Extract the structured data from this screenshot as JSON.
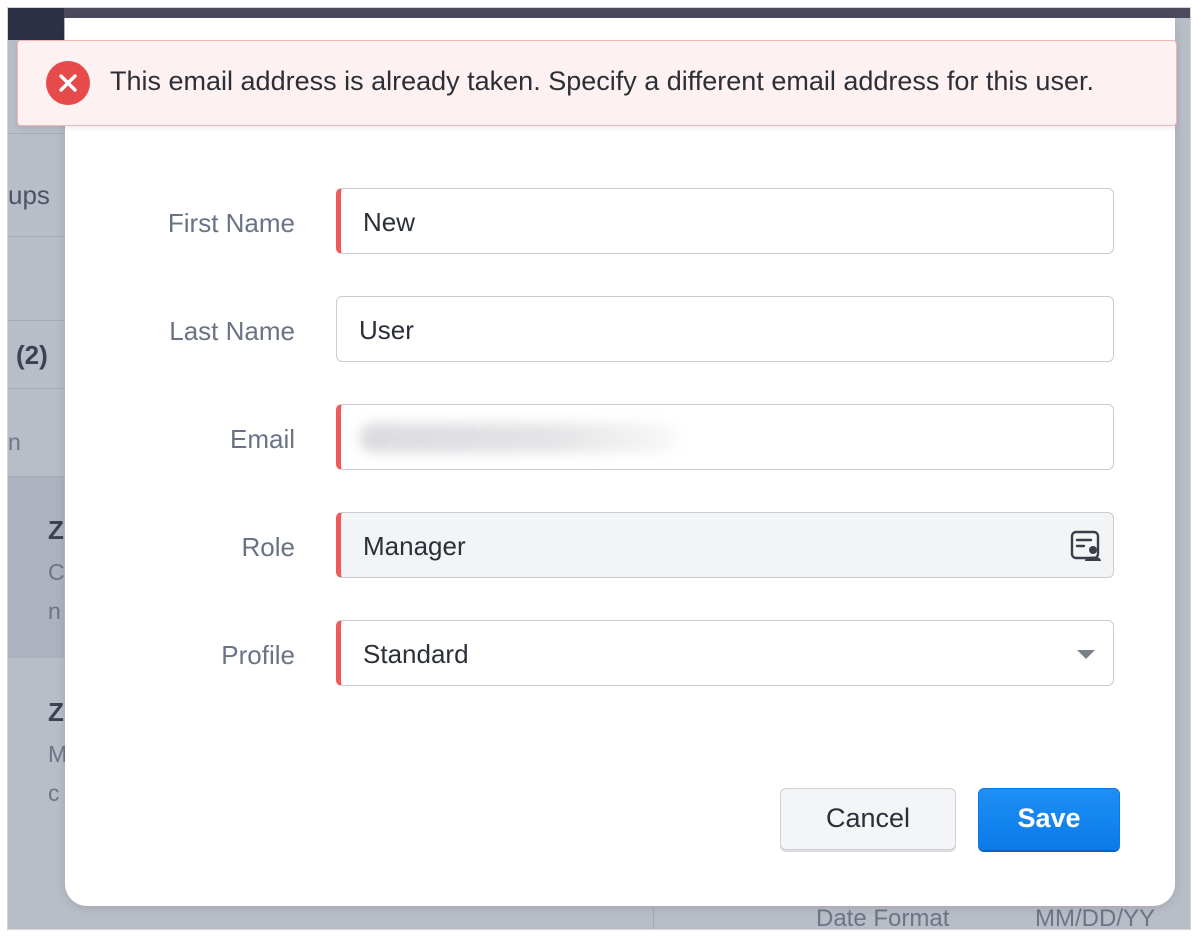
{
  "error_toast": {
    "message": "This email address is already taken. Specify a different email address for this user."
  },
  "background": {
    "fragment_groups": "ups",
    "fragment_count": "(2)",
    "fragment_n": "n",
    "fragment_z1": "Z",
    "fragment_c1": "C",
    "fragment_n2": "n",
    "fragment_z2": "Z",
    "fragment_m": "M",
    "fragment_c2": "c",
    "date_format_label": "Date Format",
    "date_format_value": "MM/DD/YY"
  },
  "form": {
    "first_name": {
      "label": "First Name",
      "value": "New"
    },
    "last_name": {
      "label": "Last Name",
      "value": "User"
    },
    "email": {
      "label": "Email"
    },
    "role": {
      "label": "Role",
      "value": "Manager",
      "icon": "role-picker-icon"
    },
    "profile": {
      "label": "Profile",
      "value": "Standard",
      "icon": "dropdown-caret-icon"
    }
  },
  "actions": {
    "cancel_label": "Cancel",
    "save_label": "Save"
  },
  "colors": {
    "error": "#e64a4a",
    "required_marker": "#ee5a5a",
    "primary": "#0b7ae9"
  }
}
